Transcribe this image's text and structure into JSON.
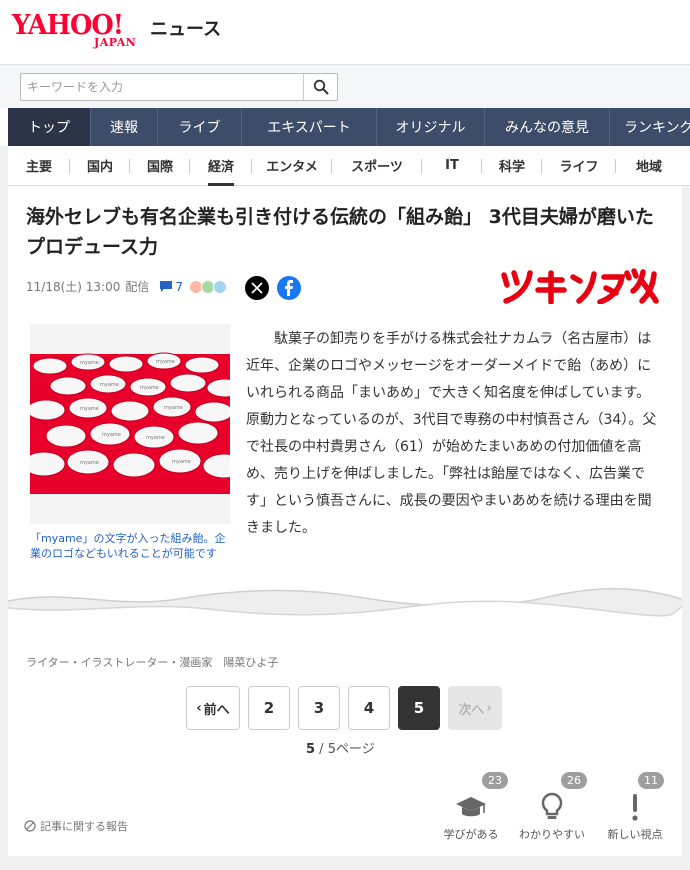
{
  "header": {
    "logo_main": "YAHOO!",
    "logo_sub": "JAPAN",
    "service": "ニュース"
  },
  "search": {
    "placeholder": "キーワードを入力",
    "button_icon": "search-icon"
  },
  "main_nav": [
    {
      "label": "トップ",
      "active": true
    },
    {
      "label": "速報"
    },
    {
      "label": "ライブ"
    },
    {
      "label": "エキスパート"
    },
    {
      "label": "オリジナル"
    },
    {
      "label": "みんなの意見"
    },
    {
      "label": "ランキング"
    }
  ],
  "sub_nav": [
    {
      "label": "主要"
    },
    {
      "label": "国内"
    },
    {
      "label": "国際"
    },
    {
      "label": "経済",
      "active": true
    },
    {
      "label": "エンタメ"
    },
    {
      "label": "スポーツ"
    },
    {
      "label": "IT"
    },
    {
      "label": "科学"
    },
    {
      "label": "ライフ"
    },
    {
      "label": "地域"
    }
  ],
  "article": {
    "title": "海外セレブも有名企業も引き付ける伝統の「組み飴」 3代目夫婦が磨いたプロデュース力",
    "date": "11/18(土) 13:00",
    "date_suffix": "配信",
    "comment_count": "7",
    "brand": "ツギノジダイ",
    "caption": "「myame」の文字が入った組み飴。企業のロゴなどもいれることが可能です",
    "body": "駄菓子の卸売りを手がける株式会社ナカムラ（名古屋市）は近年、企業のロゴやメッセージをオーダーメイドで飴（あめ）にいれられる商品「まいあめ」で大きく知名度を伸ばしています。原動力となっているのが、3代目で専務の中村慎吾さん（34）。父で社長の中村貴男さん（61）が始めたまいあめの付加価値を高め、売り上げを伸ばしました。「弊社は飴屋ではなく、広告業です」という慎吾さんに、成長の要因やまいあめを続ける理由を聞きました。",
    "author": "ライター・イラストレーター・漫画家　陽菜ひよ子"
  },
  "pager": {
    "prev": "前へ",
    "next": "次へ",
    "pages": [
      "2",
      "3",
      "4",
      "5"
    ],
    "current": "5",
    "total": "5",
    "info_suffix": "ページ",
    "info_sep": " / "
  },
  "footer": {
    "report": "記事に関する報告",
    "reactions": [
      {
        "label": "学びがある",
        "count": "23",
        "icon": "graduation-cap-icon"
      },
      {
        "label": "わかりやすい",
        "count": "26",
        "icon": "lightbulb-icon"
      },
      {
        "label": "新しい視点",
        "count": "11",
        "icon": "exclamation-icon"
      }
    ]
  },
  "colors": {
    "brand_red": "#ff0033",
    "nav_bg": "#3d4c68",
    "nav_active": "#2b3446",
    "link_blue": "#2263c6",
    "candy_red": "#e8002a"
  }
}
